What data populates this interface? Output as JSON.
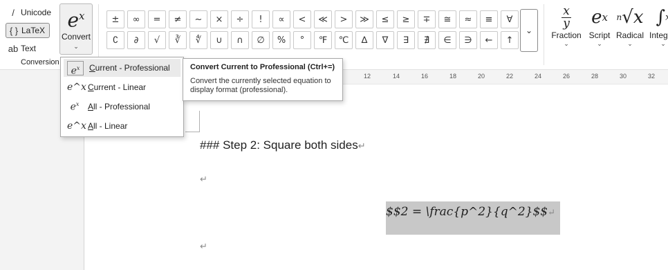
{
  "conversion": {
    "options": [
      {
        "glyph": "/",
        "label": "Unicode",
        "selected": false
      },
      {
        "glyph": "{ }",
        "label": "LaTeX",
        "selected": true
      },
      {
        "glyph": "ab",
        "label": "Text",
        "selected": false
      }
    ],
    "group_label": "Conversion",
    "convert_button": {
      "label": "Convert",
      "icon": "e-x-icon"
    }
  },
  "symbols": {
    "row1": [
      "±",
      "∞",
      "=",
      "≠",
      "~",
      "×",
      "÷",
      "!",
      "∝",
      "<",
      "≪",
      ">",
      "≫",
      "≤",
      "≥",
      "∓",
      "≅",
      "≈",
      "≡",
      "∀"
    ],
    "row2": [
      "∁",
      "∂",
      "√",
      "∛",
      "∜",
      "∪",
      "∩",
      "∅",
      "%",
      "°",
      "℉",
      "℃",
      "∆",
      "∇",
      "∃",
      "∄",
      "∈",
      "∋",
      "←",
      "↑"
    ],
    "more_icon": "chevron-down-icon"
  },
  "structures": [
    {
      "label": "Fraction"
    },
    {
      "label": "Script"
    },
    {
      "label": "Radical"
    },
    {
      "label": "Integral"
    }
  ],
  "ruler": {
    "numbers": [
      "12",
      "14",
      "16",
      "18",
      "20",
      "22",
      "24",
      "26",
      "28",
      "30",
      "32"
    ]
  },
  "document": {
    "heading": "### Step 2: Square both sides",
    "equation": "$$2  = \\frac{p^2}{q^2}$$",
    "paragraph_mark": "↵"
  },
  "dropdown": {
    "items": [
      {
        "label": "Current - Professional",
        "accel": "C",
        "rest": "urrent - Professional",
        "icon": "professional-icon"
      },
      {
        "label": "Current - Linear",
        "accel": "C",
        "rest": "urrent - Linear",
        "icon": "linear-icon"
      },
      {
        "label": "All - Professional",
        "accel": "A",
        "rest": "ll - Professional",
        "icon": "professional-icon"
      },
      {
        "label": "All - Linear",
        "accel": "A",
        "rest": "ll - Linear",
        "icon": "linear-icon"
      }
    ]
  },
  "tooltip": {
    "title": "Convert Current to Professional (Ctrl+=)",
    "description": "Convert the currently selected equation to display format (professional)."
  }
}
